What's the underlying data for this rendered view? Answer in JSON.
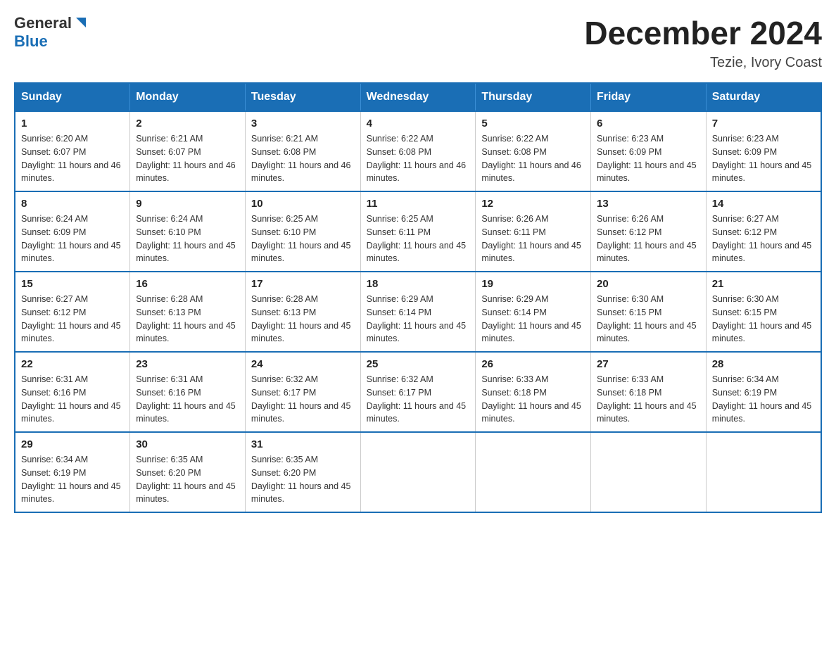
{
  "header": {
    "logo_general": "General",
    "logo_blue": "Blue",
    "month_title": "December 2024",
    "location": "Tezie, Ivory Coast"
  },
  "weekdays": [
    "Sunday",
    "Monday",
    "Tuesday",
    "Wednesday",
    "Thursday",
    "Friday",
    "Saturday"
  ],
  "weeks": [
    [
      {
        "day": "1",
        "sunrise": "6:20 AM",
        "sunset": "6:07 PM",
        "daylight": "11 hours and 46 minutes."
      },
      {
        "day": "2",
        "sunrise": "6:21 AM",
        "sunset": "6:07 PM",
        "daylight": "11 hours and 46 minutes."
      },
      {
        "day": "3",
        "sunrise": "6:21 AM",
        "sunset": "6:08 PM",
        "daylight": "11 hours and 46 minutes."
      },
      {
        "day": "4",
        "sunrise": "6:22 AM",
        "sunset": "6:08 PM",
        "daylight": "11 hours and 46 minutes."
      },
      {
        "day": "5",
        "sunrise": "6:22 AM",
        "sunset": "6:08 PM",
        "daylight": "11 hours and 46 minutes."
      },
      {
        "day": "6",
        "sunrise": "6:23 AM",
        "sunset": "6:09 PM",
        "daylight": "11 hours and 45 minutes."
      },
      {
        "day": "7",
        "sunrise": "6:23 AM",
        "sunset": "6:09 PM",
        "daylight": "11 hours and 45 minutes."
      }
    ],
    [
      {
        "day": "8",
        "sunrise": "6:24 AM",
        "sunset": "6:09 PM",
        "daylight": "11 hours and 45 minutes."
      },
      {
        "day": "9",
        "sunrise": "6:24 AM",
        "sunset": "6:10 PM",
        "daylight": "11 hours and 45 minutes."
      },
      {
        "day": "10",
        "sunrise": "6:25 AM",
        "sunset": "6:10 PM",
        "daylight": "11 hours and 45 minutes."
      },
      {
        "day": "11",
        "sunrise": "6:25 AM",
        "sunset": "6:11 PM",
        "daylight": "11 hours and 45 minutes."
      },
      {
        "day": "12",
        "sunrise": "6:26 AM",
        "sunset": "6:11 PM",
        "daylight": "11 hours and 45 minutes."
      },
      {
        "day": "13",
        "sunrise": "6:26 AM",
        "sunset": "6:12 PM",
        "daylight": "11 hours and 45 minutes."
      },
      {
        "day": "14",
        "sunrise": "6:27 AM",
        "sunset": "6:12 PM",
        "daylight": "11 hours and 45 minutes."
      }
    ],
    [
      {
        "day": "15",
        "sunrise": "6:27 AM",
        "sunset": "6:12 PM",
        "daylight": "11 hours and 45 minutes."
      },
      {
        "day": "16",
        "sunrise": "6:28 AM",
        "sunset": "6:13 PM",
        "daylight": "11 hours and 45 minutes."
      },
      {
        "day": "17",
        "sunrise": "6:28 AM",
        "sunset": "6:13 PM",
        "daylight": "11 hours and 45 minutes."
      },
      {
        "day": "18",
        "sunrise": "6:29 AM",
        "sunset": "6:14 PM",
        "daylight": "11 hours and 45 minutes."
      },
      {
        "day": "19",
        "sunrise": "6:29 AM",
        "sunset": "6:14 PM",
        "daylight": "11 hours and 45 minutes."
      },
      {
        "day": "20",
        "sunrise": "6:30 AM",
        "sunset": "6:15 PM",
        "daylight": "11 hours and 45 minutes."
      },
      {
        "day": "21",
        "sunrise": "6:30 AM",
        "sunset": "6:15 PM",
        "daylight": "11 hours and 45 minutes."
      }
    ],
    [
      {
        "day": "22",
        "sunrise": "6:31 AM",
        "sunset": "6:16 PM",
        "daylight": "11 hours and 45 minutes."
      },
      {
        "day": "23",
        "sunrise": "6:31 AM",
        "sunset": "6:16 PM",
        "daylight": "11 hours and 45 minutes."
      },
      {
        "day": "24",
        "sunrise": "6:32 AM",
        "sunset": "6:17 PM",
        "daylight": "11 hours and 45 minutes."
      },
      {
        "day": "25",
        "sunrise": "6:32 AM",
        "sunset": "6:17 PM",
        "daylight": "11 hours and 45 minutes."
      },
      {
        "day": "26",
        "sunrise": "6:33 AM",
        "sunset": "6:18 PM",
        "daylight": "11 hours and 45 minutes."
      },
      {
        "day": "27",
        "sunrise": "6:33 AM",
        "sunset": "6:18 PM",
        "daylight": "11 hours and 45 minutes."
      },
      {
        "day": "28",
        "sunrise": "6:34 AM",
        "sunset": "6:19 PM",
        "daylight": "11 hours and 45 minutes."
      }
    ],
    [
      {
        "day": "29",
        "sunrise": "6:34 AM",
        "sunset": "6:19 PM",
        "daylight": "11 hours and 45 minutes."
      },
      {
        "day": "30",
        "sunrise": "6:35 AM",
        "sunset": "6:20 PM",
        "daylight": "11 hours and 45 minutes."
      },
      {
        "day": "31",
        "sunrise": "6:35 AM",
        "sunset": "6:20 PM",
        "daylight": "11 hours and 45 minutes."
      },
      null,
      null,
      null,
      null
    ]
  ],
  "labels": {
    "sunrise": "Sunrise:",
    "sunset": "Sunset:",
    "daylight": "Daylight:"
  }
}
